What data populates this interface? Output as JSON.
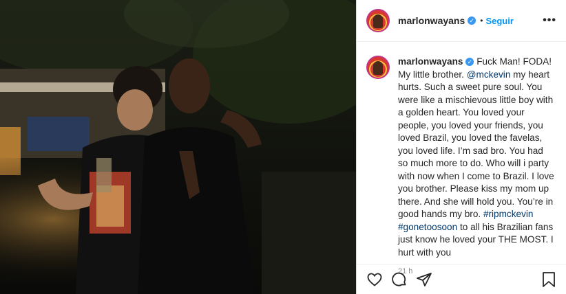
{
  "header": {
    "username": "marlonwayans",
    "dot": "•",
    "follow_label": "Seguir",
    "more_label": "•••"
  },
  "caption": {
    "username": "marlonwayans",
    "part1": "Fuck Man! FODA! My little brother. ",
    "mention": "@mckevin",
    "part2": " my heart hurts. Such a sweet pure soul. You were like a mischievous little boy with a golden heart. You loved your people, you loved your friends, you loved Brazil, you loved the favelas, you loved life. I’m sad bro. You had so much more to do. Who will i party with now when I come to Brazil. I love you brother. Please kiss my mom up there. And she will hold you. You’re in good hands my bro. ",
    "hashtag1": "#ripmckevin",
    "hashtag2": "#gonetoosoon",
    "part3": " to all his Brazilian fans just know he loved your THE MOST. I hurt with you"
  },
  "timestamp": "21 h",
  "icons": {
    "like": "heart-icon",
    "comment": "comment-icon",
    "share": "share-icon",
    "save": "bookmark-icon",
    "verified": "verified-badge-icon"
  },
  "colors": {
    "accent": "#0095f6",
    "verified": "#3897f0",
    "link": "#00376b",
    "text": "#262626",
    "muted": "#8e8e8e"
  }
}
